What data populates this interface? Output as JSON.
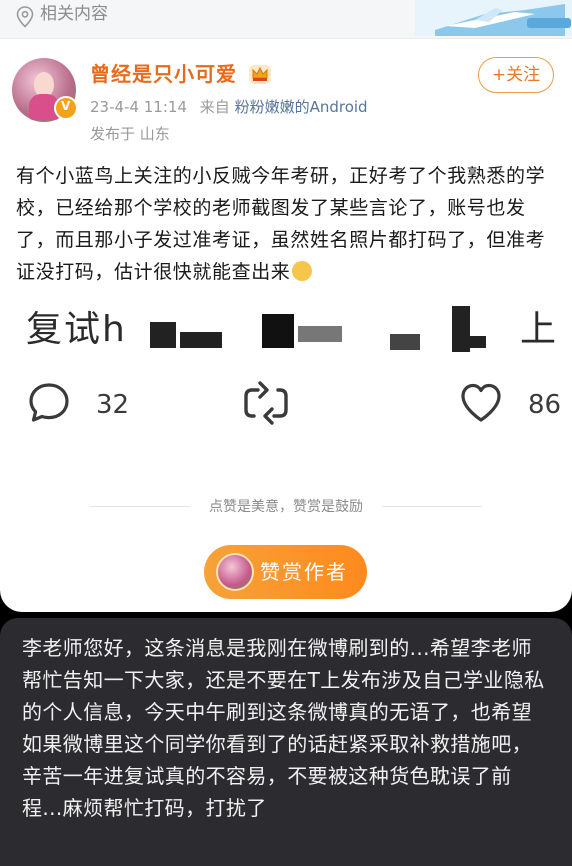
{
  "related": {
    "label": "相关内容"
  },
  "profile": {
    "username": "曾经是只小可爱",
    "date": "23-4-4 11:14",
    "from_prefix": "来自",
    "source": "粉粉嫩嫩的Android",
    "location": "发布于 山东",
    "follow_label": "+关注"
  },
  "post": {
    "text": "有个小蓝鸟上关注的小反贼今年考研，正好考了个我熟悉的学校，已经给那个学校的老师截图发了某些言论了，账号也发了，而且那小子发过准考证，虽然姓名照片都打码了，但准考证没打码，估计很快就能查出来",
    "censored_left": "复试h",
    "censored_right": "上"
  },
  "actions": {
    "comments": "32",
    "likes": "86"
  },
  "reward": {
    "hint": "点赞是美意，赞赏是鼓励",
    "button_label": "赞赏作者"
  },
  "message": {
    "text": "李老师您好，这条消息是我刚在微博刷到的...希望李老师帮忙告知一下大家，还是不要在T上发布涉及自己学业隐私的个人信息，今天中午刷到这条微博真的无语了，也希望如果微博里这个同学你看到了的话赶紧采取补救措施吧，辛苦一年进复试真的不容易，不要被这种货色耽误了前程...麻烦帮忙打码，打扰了"
  },
  "colors": {
    "accent": "#e86b1c",
    "follow": "#e8792c",
    "source_link": "#56759b",
    "reward_bg": "#ff8a1d",
    "message_bg": "#2c2c30"
  },
  "icons": [
    "location-pin-icon",
    "crown-icon",
    "comment-icon",
    "repost-icon",
    "like-icon",
    "verified-icon"
  ]
}
